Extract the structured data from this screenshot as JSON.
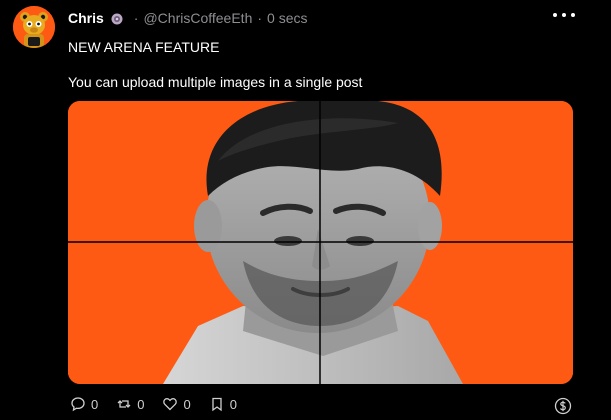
{
  "post": {
    "author": {
      "display_name": "Chris",
      "badge_icon": "coffee-badge-icon",
      "handle": "@ChrisCoffeeEth",
      "separator": "·",
      "timestamp": "0 secs",
      "avatar_icon": "bear-avatar-icon",
      "avatar_bg": "#ff5a14"
    },
    "more_icon": "more-dots-icon",
    "text_lines": [
      "NEW ARENA FEATURE",
      "You can upload multiple images in a single post"
    ],
    "image_grid": {
      "image_count": 4,
      "background": "#ff5a14",
      "subject": "grayscale-portrait"
    },
    "actions": {
      "comments": {
        "icon": "comment-icon",
        "count": "0"
      },
      "reposts": {
        "icon": "repost-icon",
        "count": "0"
      },
      "likes": {
        "icon": "heart-icon",
        "count": "0"
      },
      "bookmarks": {
        "icon": "bookmark-icon",
        "count": "0"
      },
      "tip": {
        "icon": "dollar-tip-icon"
      }
    }
  }
}
